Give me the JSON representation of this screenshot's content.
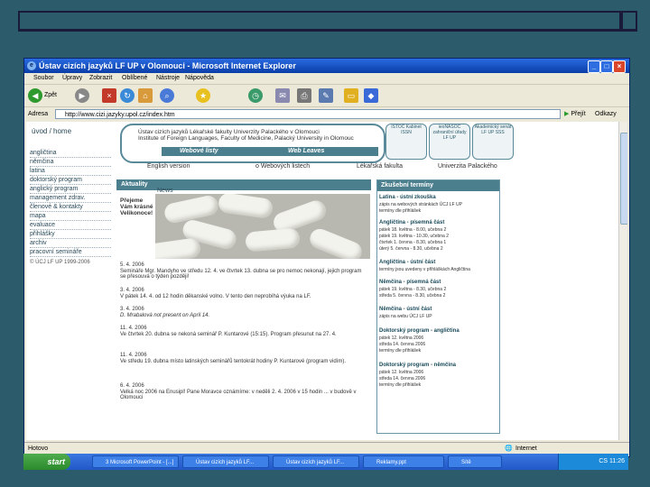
{
  "window": {
    "title": "Ústav cizích jazyků LF UP v Olomouci - Microsoft Internet Explorer"
  },
  "menubar": {
    "items": [
      "Soubor",
      "Úpravy",
      "Zobrazit",
      "Oblíbené",
      "Nástroje",
      "Nápověda"
    ]
  },
  "toolbar": {
    "back_label": "Zpět"
  },
  "address": {
    "label": "Adresa",
    "url": "http://www.cizi.jazyky.upol.cz/index.htm",
    "go_label": "Přejít",
    "links_label": "Odkazy"
  },
  "site": {
    "header": {
      "line1": "Ústav cizích jazyků Lékařské fakulty Univerzity Palackého v Olomouci",
      "line2": "Institute of Foreign Languages, Faculty of Medicine, Palacký University in Olomouc",
      "web_tab1": "Webové listy",
      "web_tab2": "Web Leaves"
    },
    "logos": [
      "ISTOČ Kabinet ISSN",
      "ieoNASOC zahraniční úřady LF UP",
      "Akademický senát LF UP SSS"
    ],
    "nav_links": [
      "English version",
      "o Webových listech",
      "Lékařská fakulta",
      "Univerzita Palackého"
    ],
    "leftnav": {
      "home": "úvod / home",
      "items": [
        "angličtina",
        "němčina",
        "latina",
        "doktorský program",
        "anglický program",
        "management zdrav.",
        "členové & kontakty",
        "mapa",
        "evaluace",
        "přihlášky",
        "archiv",
        "pracovní semináře"
      ],
      "copyright": "© ÚCJ LF UP 1999-2006"
    },
    "aktuality": {
      "title": "Aktuality",
      "tab": "News",
      "headline": "Přejeme Vám krásné Velikonoce!",
      "posts": [
        {
          "date": "5. 4. 2006",
          "text": "Semináře Mgr. Mandyho ve středu 12. 4. ve čtvrtek 13. dubna se pro nemoc nekonají, jejich program se přesouvá o týden později!"
        },
        {
          "date": "3. 4. 2006",
          "text": "V pátek 14. 4. od 12 hodin děkanské volno. V tento den neprobíhá výuka na LF."
        },
        {
          "date": "3. 4. 2006",
          "text": "D. Mrabalová not present on April 14."
        },
        {
          "date": "11. 4. 2006",
          "text": "Ve čtvrtek 20. dubna se nekoná seminář P. Kuntarové (15:15). Program přesunut na 27. 4."
        },
        {
          "date": "11. 4. 2006",
          "text": "Ve středu 19. dubna místo latinských seminářů tentokrát hodiny P. Kuntarové (program vidím)."
        },
        {
          "date": "6. 4. 2006",
          "text": "Velká noc 2006 na Enusipl! Pane Moravce oznámíme: v neděli 2. 4. 2006 v 15 hodin ... v budově v Olomouci"
        }
      ]
    },
    "skusebni": {
      "title": "Zkušební termíny",
      "sections": [
        {
          "heading": "Latina - ústní zkouška",
          "lines": [
            "zápis na webových stránkách ÚCJ LF UP",
            "termíny dle přihlášek"
          ]
        },
        {
          "heading": "Angličtina - písemná část",
          "lines": [
            "pátek 18. května - 8.00, učebna 2",
            "pátek 19. května - 10.30, učebna 2",
            "čtvrtek 1. června - 8.30, učebna 1",
            "úterý 5. června - 8.30, učebna 2"
          ]
        },
        {
          "heading": "Angličtina - ústní část",
          "lines": [
            "termíny jsou uvedeny v přihláškách Angličtina"
          ]
        },
        {
          "heading": "Němčina - písemná část",
          "lines": [
            "pátek 19. května - 8.30, učebna 2",
            "středa 5. června - 8.30, učebna 2"
          ]
        },
        {
          "heading": "Němčina - ústní část",
          "lines": [
            "zápis na webu ÚCJ LF UP"
          ]
        },
        {
          "heading": "Doktorský program - angličtina",
          "lines": [
            "pátek 12. května 2006",
            "středa 14. června 2006",
            "termíny dle přihlášek"
          ]
        },
        {
          "heading": "Doktorský program - němčina",
          "lines": [
            "pátek 12. května 2006",
            "středa 14. června 2006",
            "termíny dle přihlášek"
          ]
        }
      ]
    }
  },
  "status": {
    "left": "Hotovo",
    "zone": "Internet"
  },
  "taskbar": {
    "start_label": "start",
    "tasks": [
      "3 Microsoft PowerPoint - [...]",
      "Ústav cizích jazyků LF...",
      "Ústav cizích jazyků LF...",
      "Ústav cizích jazyků LF...",
      "Reklamy.ppt",
      "Sítě",
      "Microsoft..."
    ],
    "clock": "CS 11:26"
  }
}
